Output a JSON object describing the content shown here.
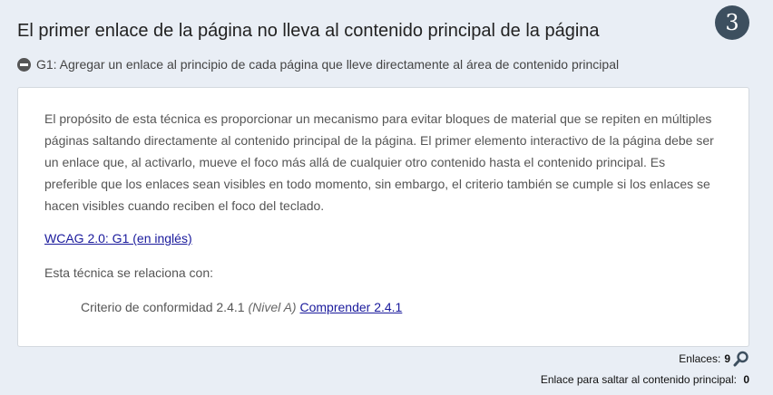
{
  "header": {
    "title": "El primer enlace de la página no lleva al contenido principal de la página",
    "badge_number": "3"
  },
  "technique": {
    "label": "G1: Agregar un enlace al principio de cada página que lleve directamente al área de contenido principal",
    "toggle_icon": "minus-circle-icon"
  },
  "panel": {
    "description": "El propósito de esta técnica es proporcionar un mecanismo para evitar bloques de material que se repiten en múltiples páginas saltando directamente al contenido principal de la página. El primer elemento interactivo de la página debe ser un enlace que, al activarlo, mueve el foco más allá de cualquier otro contenido hasta el contenido principal. Es preferible que los enlaces sean visibles en todo momento, sin embargo, el criterio también se cumple si los enlaces se hacen visibles cuando reciben el foco del teclado.",
    "wcag_link": "WCAG 2.0: G1 (en inglés)",
    "related_label": "Esta técnica se relaciona con:",
    "criterion_text": "Criterio de conformidad 2.4.1",
    "criterion_level": "(Nivel A)",
    "understand_link": "Comprender 2.4.1"
  },
  "footer": {
    "links_label": "Enlaces:",
    "links_count": "9",
    "skip_label": "Enlace para saltar al contenido principal:",
    "skip_count": "0"
  },
  "colors": {
    "background": "#e9eef5",
    "badge": "#3d4f5f",
    "link": "#1a1a9c"
  }
}
